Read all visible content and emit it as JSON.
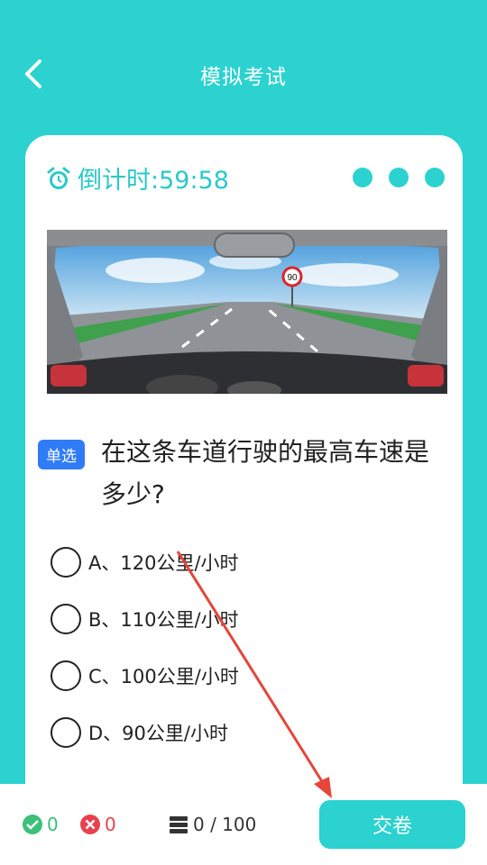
{
  "header": {
    "title": "模拟考试",
    "back_icon": "chevron-left-icon"
  },
  "timer": {
    "label": "倒计时:59:58",
    "icon": "alarm-clock-icon"
  },
  "question": {
    "type_tag": "单选",
    "text": "在这条车道行驶的最高车速是多少?",
    "sign_value": "90"
  },
  "options": [
    {
      "label": "A、120公里/小时"
    },
    {
      "label": "B、110公里/小时"
    },
    {
      "label": "C、100公里/小时"
    },
    {
      "label": "D、90公里/小时"
    }
  ],
  "footer": {
    "correct_count": "0",
    "wrong_count": "0",
    "progress": "0 / 100",
    "submit_label": "交卷"
  },
  "colors": {
    "accent": "#2BD2D0",
    "tag": "#2F7CF6",
    "correct": "#3CC07A",
    "wrong": "#E8414E",
    "annotation_arrow": "#E5453B"
  }
}
